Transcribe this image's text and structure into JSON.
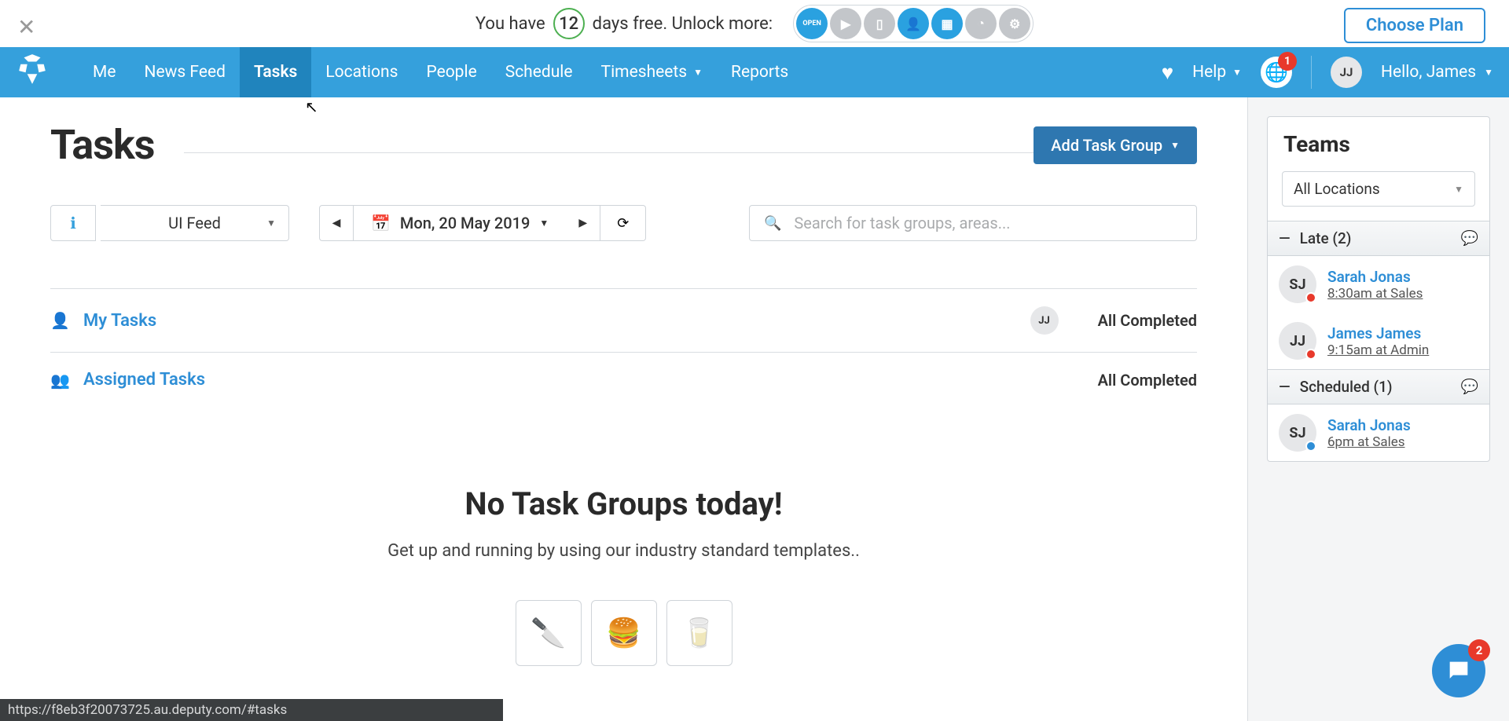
{
  "trial": {
    "prefix": "You have",
    "days": "12",
    "suffix": "days free. Unlock more:",
    "open_label": "OPEN",
    "choose_plan": "Choose Plan"
  },
  "nav": {
    "items": [
      "Me",
      "News Feed",
      "Tasks",
      "Locations",
      "People",
      "Schedule",
      "Timesheets",
      "Reports"
    ],
    "active_index": 2,
    "help": "Help",
    "notif_count": "1",
    "user_initials": "JJ",
    "hello": "Hello, James"
  },
  "page": {
    "title": "Tasks",
    "add_group": "Add Task Group"
  },
  "toolbar": {
    "feed": "UI Feed",
    "date": "Mon, 20 May 2019",
    "search_placeholder": "Search for task groups, areas..."
  },
  "task_sections": [
    {
      "icon": "user",
      "name": "My Tasks",
      "avatar": "JJ",
      "status": "All Completed"
    },
    {
      "icon": "users",
      "name": "Assigned Tasks",
      "avatar": "",
      "status": "All Completed"
    }
  ],
  "empty": {
    "title": "No Task Groups today!",
    "sub": "Get up and running by using our industry standard templates.."
  },
  "sidebar": {
    "title": "Teams",
    "location": "All Locations",
    "groups": [
      {
        "label": "Late (2)",
        "people": [
          {
            "initials": "SJ",
            "name": "Sarah Jonas",
            "sub": "8:30am at Sales",
            "dot": "red"
          },
          {
            "initials": "JJ",
            "name": "James James",
            "sub": "9:15am at Admin",
            "dot": "red"
          }
        ]
      },
      {
        "label": "Scheduled (1)",
        "people": [
          {
            "initials": "SJ",
            "name": "Sarah Jonas",
            "sub": "6pm at Sales",
            "dot": "blue"
          }
        ]
      }
    ]
  },
  "intercom_count": "2",
  "status_url": "https://f8eb3f20073725.au.deputy.com/#tasks"
}
